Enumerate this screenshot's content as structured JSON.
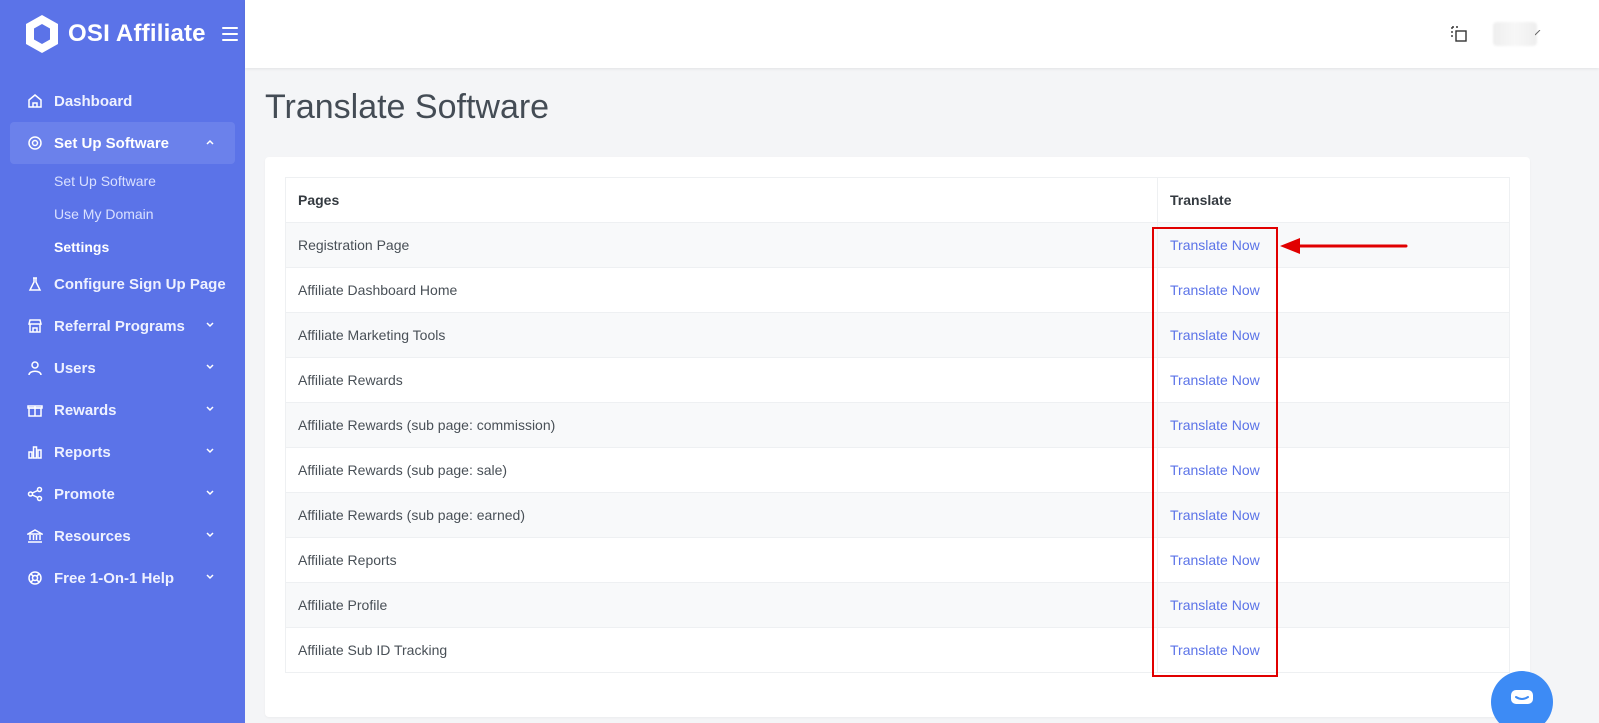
{
  "brand": {
    "name": "OSI Affiliate"
  },
  "sidebar": {
    "items": [
      {
        "label": "Dashboard",
        "icon": "home-icon"
      },
      {
        "label": "Set Up Software",
        "icon": "gear-icon",
        "expanded": true,
        "children": [
          {
            "label": "Set Up Software"
          },
          {
            "label": "Use My Domain"
          },
          {
            "label": "Settings",
            "current": true
          }
        ]
      },
      {
        "label": "Configure Sign Up Page",
        "icon": "flask-icon"
      },
      {
        "label": "Referral Programs",
        "icon": "store-icon"
      },
      {
        "label": "Users",
        "icon": "user-icon"
      },
      {
        "label": "Rewards",
        "icon": "gift-icon"
      },
      {
        "label": "Reports",
        "icon": "bar-chart-icon"
      },
      {
        "label": "Promote",
        "icon": "share-icon"
      },
      {
        "label": "Resources",
        "icon": "bank-icon"
      },
      {
        "label": "Free 1-On-1 Help",
        "icon": "lifebuoy-icon"
      }
    ]
  },
  "page": {
    "title": "Translate Software"
  },
  "table": {
    "headers": [
      "Pages",
      "Translate"
    ],
    "rows": [
      {
        "page": "Registration Page",
        "action": "Translate Now"
      },
      {
        "page": "Affiliate Dashboard Home",
        "action": "Translate Now"
      },
      {
        "page": "Affiliate Marketing Tools",
        "action": "Translate Now"
      },
      {
        "page": "Affiliate Rewards",
        "action": "Translate Now"
      },
      {
        "page": "Affiliate Rewards (sub page: commission)",
        "action": "Translate Now"
      },
      {
        "page": "Affiliate Rewards (sub page: sale)",
        "action": "Translate Now"
      },
      {
        "page": "Affiliate Rewards (sub page: earned)",
        "action": "Translate Now"
      },
      {
        "page": "Affiliate Reports",
        "action": "Translate Now"
      },
      {
        "page": "Affiliate Profile",
        "action": "Translate Now"
      },
      {
        "page": "Affiliate Sub ID Tracking",
        "action": "Translate Now"
      }
    ]
  },
  "colors": {
    "sidebar_bg": "#5b73e8",
    "accent": "#5b73e8",
    "annotation": "#e10000",
    "chat": "#3d8bf5"
  }
}
